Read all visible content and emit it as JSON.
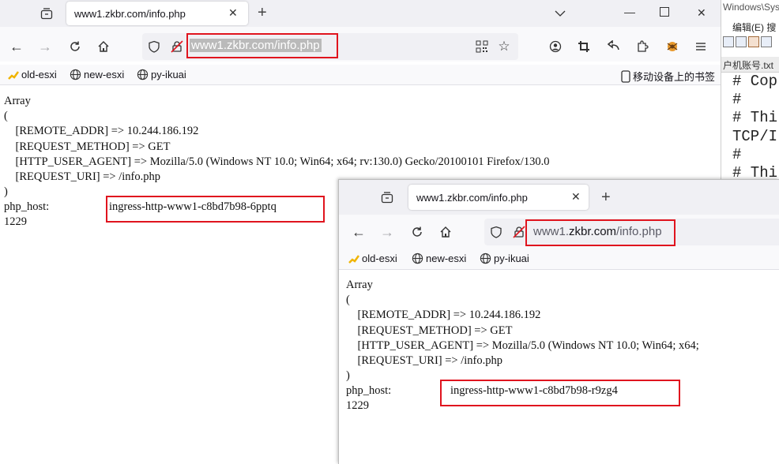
{
  "background_window": {
    "title": "Windows\\Syste",
    "menu": "编辑(E)  搜",
    "tab": "户机账号.txt",
    "lines": [
      "# Cop",
      "#",
      "# Thi",
      "TCP/I",
      "#",
      "# Thi"
    ]
  },
  "browser1": {
    "tab_title": "www1.zkbr.com/info.php",
    "url": "www1.zkbr.com/info.php",
    "bookmarks": [
      "old-esxi",
      "new-esxi",
      "py-ikuai"
    ],
    "mobile_bookmarks": "移动设备上的书签",
    "array_block": "Array\n(\n    [REMOTE_ADDR] => 10.244.186.192\n    [REQUEST_METHOD] => GET\n    [HTTP_USER_AGENT] => Mozilla/5.0 (Windows NT 10.0; Win64; x64; rv:130.0) Gecko/20100101 Firefox/130.0\n    [REQUEST_URI] => /info.php\n)",
    "php_host_label": "php_host:",
    "php_host_value": "ingress-http-www1-c8bd7b98-6pptq",
    "number": "1229"
  },
  "browser2": {
    "tab_title": "www1.zkbr.com/info.php",
    "url_prefix": "www1.",
    "url_host": "zkbr.com",
    "url_path": "/info.php",
    "bookmarks": [
      "old-esxi",
      "new-esxi",
      "py-ikuai"
    ],
    "array_block": "Array\n(\n    [REMOTE_ADDR] => 10.244.186.192\n    [REQUEST_METHOD] => GET\n    [HTTP_USER_AGENT] => Mozilla/5.0 (Windows NT 10.0; Win64; x64;\n    [REQUEST_URI] => /info.php\n)",
    "php_host_label": "php_host:",
    "php_host_value": "ingress-http-www1-c8bd7b98-r9zg4",
    "number": "1229"
  },
  "colors": {
    "highlight_box": "#e0141e",
    "tabbar": "#f0f0f4",
    "toolbar": "#f9f9fb",
    "url_selection": "#bababa"
  },
  "icons": [
    "tab-list-icon",
    "close-icon",
    "plus-icon",
    "chevron-down-icon",
    "minimize-icon",
    "maximize-icon",
    "back-arrow-icon",
    "forward-arrow-icon",
    "reload-icon",
    "home-icon",
    "shield-icon",
    "lock-slash-icon",
    "qr-code-icon",
    "star-icon",
    "account-icon",
    "screenshot-icon",
    "share-icon",
    "extensions-icon",
    "addon-icon",
    "menu-icon",
    "folder-icon",
    "globe-icon",
    "mobile-icon"
  ]
}
